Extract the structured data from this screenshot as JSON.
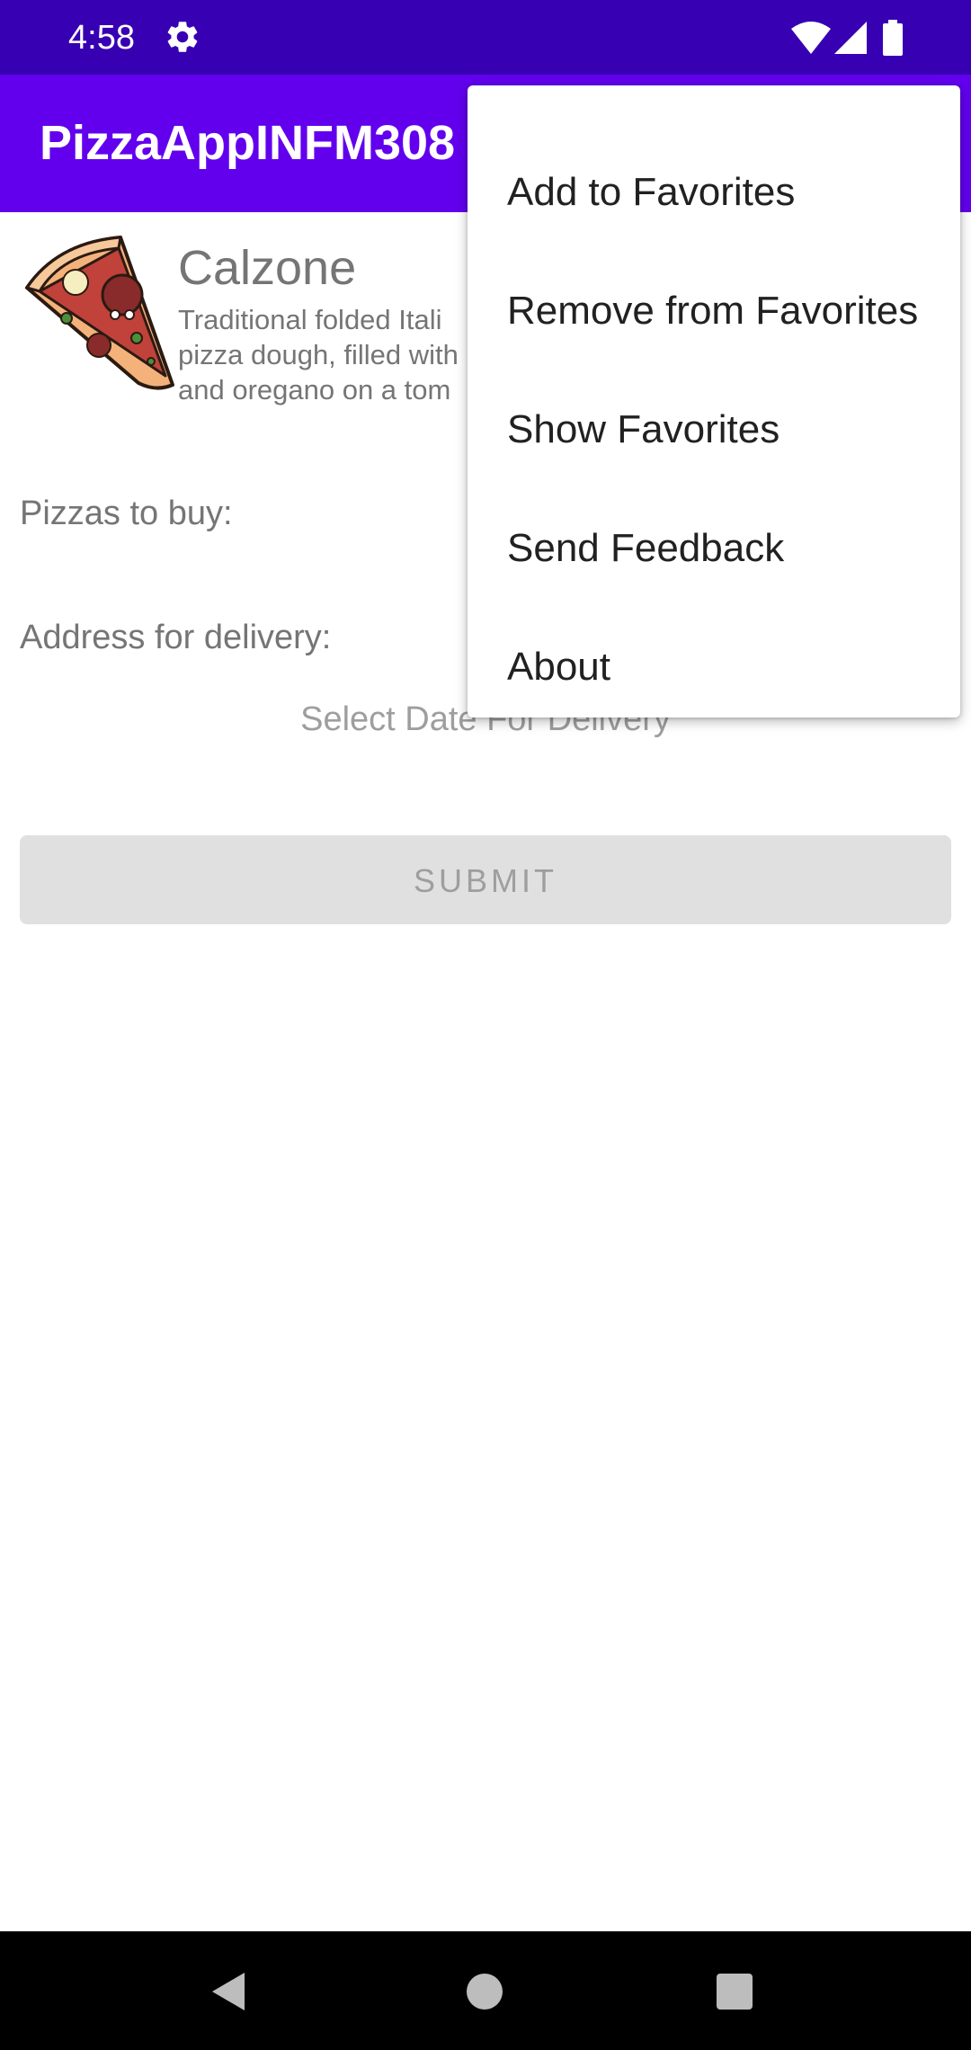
{
  "status_bar": {
    "time": "4:58",
    "icons": [
      "gear-icon",
      "wifi-icon",
      "signal-icon",
      "battery-icon"
    ]
  },
  "app_bar": {
    "title": "PizzaAppINFM308",
    "color": "#6200ee"
  },
  "pizza": {
    "name": "Calzone",
    "description": "Traditional folded Itali\npizza dough, filled with\nand oregano on a tom"
  },
  "form": {
    "quantity_label": "Pizzas to buy:",
    "address_label": "Address for delivery:",
    "date_label": "Select Date For Delivery",
    "submit_label": "SUBMIT"
  },
  "overflow_menu": {
    "items": [
      "Add to Favorites",
      "Remove from Favorites",
      "Show Favorites",
      "Send Feedback",
      "About"
    ]
  },
  "nav_bar": {
    "icons": [
      "back-icon",
      "home-icon",
      "recents-icon"
    ]
  },
  "colors": {
    "status_bar": "#3700b3",
    "app_bar": "#6200ee",
    "text_secondary": "#757575"
  }
}
